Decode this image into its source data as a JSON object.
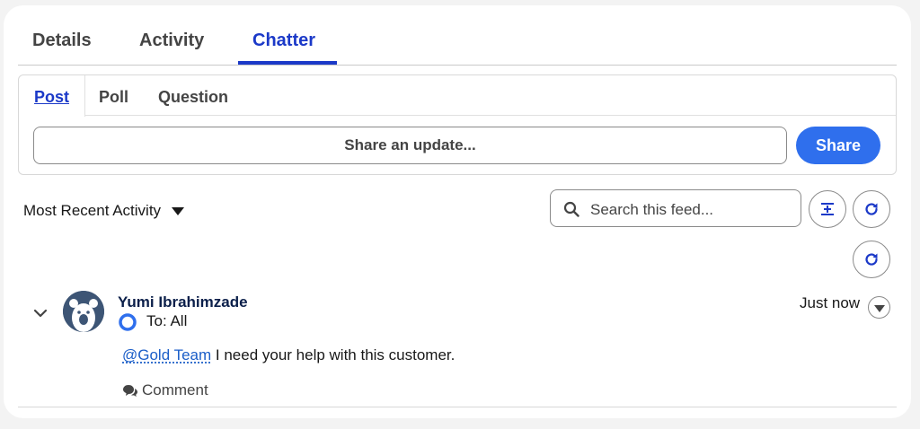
{
  "tabs": {
    "details": "Details",
    "activity": "Activity",
    "chatter": "Chatter",
    "active": "Chatter"
  },
  "publisher": {
    "tabs": {
      "post": "Post",
      "poll": "Poll",
      "question": "Question"
    },
    "input_placeholder": "Share an update...",
    "share_button": "Share"
  },
  "feed": {
    "sort_label": "Most Recent Activity",
    "search_placeholder": "Search this feed...",
    "icons": {
      "search": "search-icon",
      "expand_collapse": "expand-collapse-icon",
      "refresh": "refresh-icon"
    }
  },
  "post": {
    "author": "Yumi Ibrahimzade",
    "audience": "To: All",
    "timestamp": "Just now",
    "mention": "@Gold Team",
    "body": " I need your help with this customer.",
    "comment_label": "Comment"
  },
  "colors": {
    "brand_blue": "#1b39c8",
    "button_blue": "#2f6fed",
    "avatar_bg": "#3d5575",
    "link_blue": "#1b5ec8"
  }
}
